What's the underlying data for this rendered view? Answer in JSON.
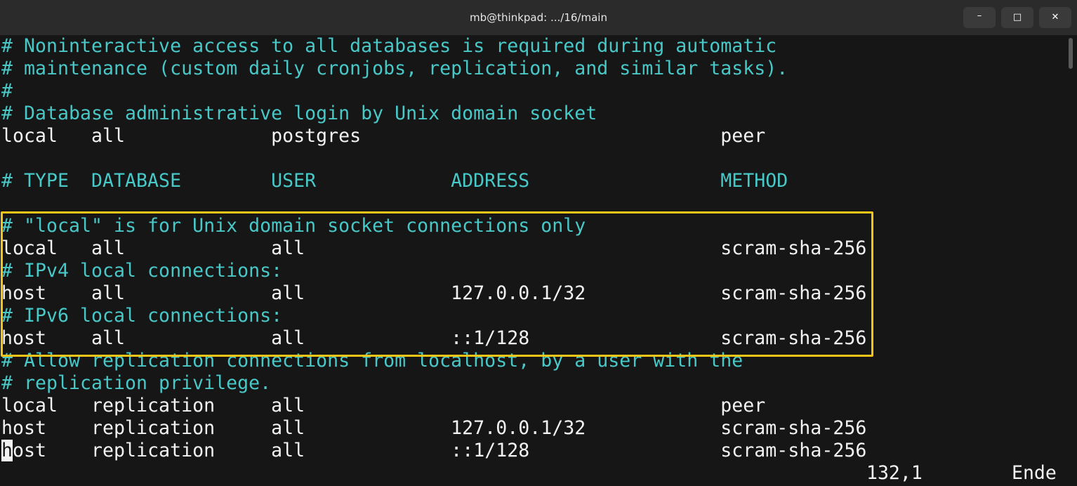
{
  "window": {
    "title": "mb@thinkpad: .../16/main",
    "minimize_label": "–",
    "maximize_label": "□",
    "close_label": "✕"
  },
  "colors": {
    "background": "#161616",
    "titlebar": "#2b2b2b",
    "comment": "#49c8c8",
    "text": "#f2f2f2",
    "highlight_border": "#f5c518"
  },
  "editor": {
    "lines": [
      "# Noninteractive access to all databases is required during automatic",
      "# maintenance (custom daily cronjobs, replication, and similar tasks).",
      "#",
      "# Database administrative login by Unix domain socket",
      "local   all             postgres                                peer",
      "",
      "# TYPE  DATABASE        USER            ADDRESS                 METHOD",
      "",
      "# \"local\" is for Unix domain socket connections only",
      "local   all             all                                     scram-sha-256",
      "# IPv4 local connections:",
      "host    all             all             127.0.0.1/32            scram-sha-256",
      "# IPv6 local connections:",
      "host    all             all             ::1/128                 scram-sha-256",
      "# Allow replication connections from localhost, by a user with the",
      "# replication privilege.",
      "local   replication     all                                     peer",
      "host    replication     all             127.0.0.1/32            scram-sha-256",
      "host    replication     all             ::1/128                 scram-sha-256"
    ],
    "cursor_char": "h",
    "last_line_rest": "ost    replication     all             ::1/128                 scram-sha-256"
  },
  "status": {
    "position": "132,1",
    "scroll": "Ende"
  }
}
